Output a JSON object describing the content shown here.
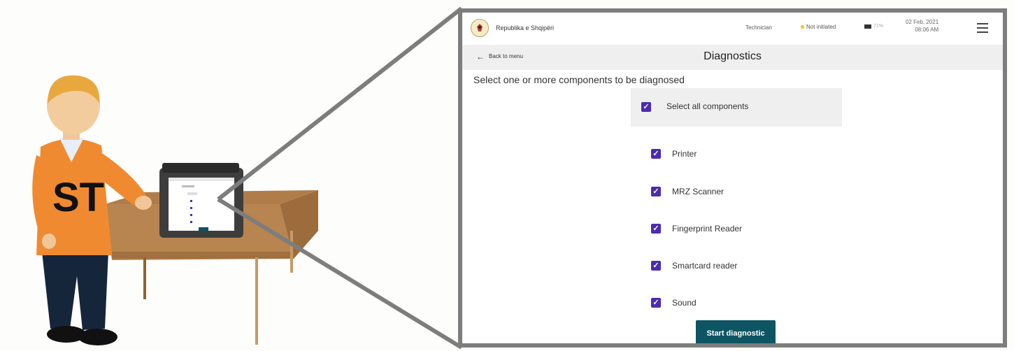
{
  "scene": {
    "operator_badge": "ST"
  },
  "header": {
    "country": "Republika e Shqipëri",
    "role": "Technician",
    "status": "Not initiated",
    "battery": "71%",
    "date": "02 Feb, 2021",
    "time": "08:06 AM"
  },
  "nav": {
    "back_label": "Back to menu",
    "title": "Diagnostics"
  },
  "main": {
    "instruction": "Select one or more components to be diagnosed",
    "select_all_label": "Select all components",
    "components": [
      {
        "label": "Printer",
        "checked": true
      },
      {
        "label": "MRZ Scanner",
        "checked": true
      },
      {
        "label": "Fingerprint Reader",
        "checked": true
      },
      {
        "label": "Smartcard reader",
        "checked": true
      },
      {
        "label": "Sound",
        "checked": true
      }
    ],
    "start_label": "Start diagnostic"
  },
  "colors": {
    "checkbox": "#4b2bb3",
    "button": "#0d5563",
    "status_dot": "#f1c40f",
    "operator_shirt": "#f08a30",
    "frame": "#7d7d7d"
  }
}
